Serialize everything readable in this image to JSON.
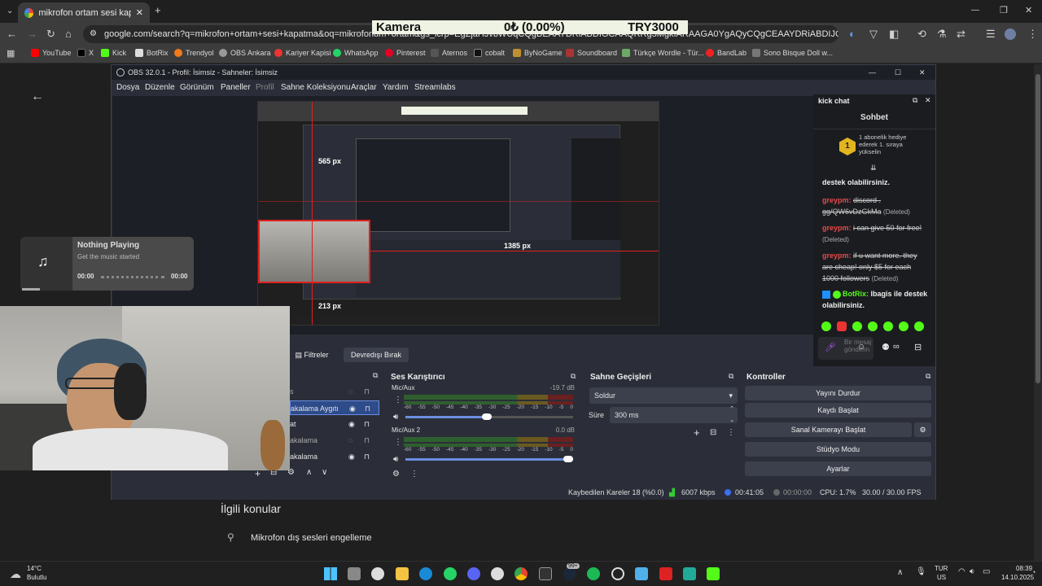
{
  "browser": {
    "tab_title": "mikrofon ortam sesi kapatma -",
    "url": "google.com/search?q=mikrofon+ortam+sesi+kapatma&oq=mikrofonum+ortam&gs_lcrp=EgZjaHJvbWUqCQgBEAAYDRiABDIGCAAQRRg5MgkIARAAGA0YgAQyCQgCEAAYDRiABDIJCAMQABgNGIAEMgkIBBAAGA0YgAQyCQgFEAAYDRiABDIJCAYQABgNGIAEMgkIBxAAGA0YgAQyCQgIEAAYDRiABDIJCAkQABgNGIAE0gEIMzM5MmowajeoAgCwAgA&sourceid=chrome&ie=UTF-8",
    "bookmarks": [
      "YouTube",
      "X",
      "Kick",
      "BotRix",
      "Trendyol",
      "OBS Ankara",
      "Kariyer Kapisi",
      "WhatsApp",
      "Pinterest",
      "Aternos",
      "cobalt",
      "ByNoGame",
      "Soundboard",
      "Türkçe Wordle - Tür...",
      "BandLab",
      "Sono Bisque Doll w..."
    ]
  },
  "ticker": {
    "left": "Kamera",
    "center": "0₺ (0.00%)",
    "right": "TRY3000"
  },
  "page": {
    "related_heading": "İlgili konular",
    "related_item": "Mikrofon dış sesleri engelleme"
  },
  "music": {
    "title": "Nothing Playing",
    "subtitle": "Get the music started",
    "time_left": "00:00",
    "time_right": "00:00"
  },
  "obs": {
    "title": "OBS 32.0.1 - Profil: İsimsiz - Sahneler: İsimsiz",
    "menu": [
      "Dosya",
      "Düzenle",
      "Görünüm",
      "Paneller",
      "Profil",
      "Sahne Koleksiyonu",
      "Araçlar",
      "Yardım",
      "Streamlabs"
    ],
    "dims": {
      "top": "565 px",
      "right": "1385 px",
      "bottom": "213 px"
    },
    "filters_label": "Filtreler",
    "deactivate_label": "Devredışı Bırak",
    "sources": [
      "s",
      "akalama Aygıtı",
      "at",
      "akalama",
      "akalama"
    ],
    "mixer": {
      "title": "Ses Karıştırıcı",
      "tracks": [
        {
          "name": "Mic/Aux",
          "db": "-19.7 dB",
          "level": 0.72
        },
        {
          "name": "Mic/Aux 2",
          "db": "0.0 dB",
          "level": 0.55
        }
      ],
      "scale": [
        "-60",
        "-55",
        "-50",
        "-45",
        "-40",
        "-35",
        "-30",
        "-25",
        "-20",
        "-15",
        "-10",
        "-5",
        "0"
      ]
    },
    "transitions": {
      "title": "Sahne Geçişleri",
      "selected": "Soldur",
      "duration_label": "Süre",
      "duration": "300 ms"
    },
    "controls": {
      "title": "Kontroller",
      "buttons": [
        "Yayını Durdur",
        "Kaydı Başlat",
        "Sanal Kamerayı Başlat",
        "Stüdyo Modu",
        "Ayarlar"
      ]
    },
    "status": {
      "dropped": "Kaybedilen Kareler 18 (%0.0)",
      "bitrate": "6007 kbps",
      "live_time": "00:41:05",
      "rec_time": "00:00:00",
      "cpu": "CPU: 1.7%",
      "fps": "30.00 / 30.00 FPS"
    }
  },
  "chat": {
    "dock_title": "kick chat",
    "header": "Sohbet",
    "badge_number": "1",
    "badge_text": "1 abonelik hediye ederek 1. sıraya yükselin",
    "line1": "destek olabilirsiniz.",
    "messages": [
      {
        "user": "greypm:",
        "text": "discord . gg/QW6vDzGkMa",
        "tag": "(Deleted)"
      },
      {
        "user": "greypm:",
        "text": "i can give 50 for free!",
        "tag": "(Deleted)"
      },
      {
        "user": "greypm:",
        "text": "if u want more. they are cheap! only $5 for each 1000 followers",
        "tag": "(Deleted)"
      }
    ],
    "bot_user": "BotRix:",
    "bot_text": "lbagis ile destek olabilirsiniz.",
    "input_placeholder": "Bir mesaj gönderin"
  },
  "taskbar": {
    "weather_temp": "14°C",
    "weather_desc": "Bulutlu",
    "lang1": "TUR",
    "lang2": "US",
    "time": "08:39",
    "date": "14.10.2025",
    "badge": "99+"
  }
}
